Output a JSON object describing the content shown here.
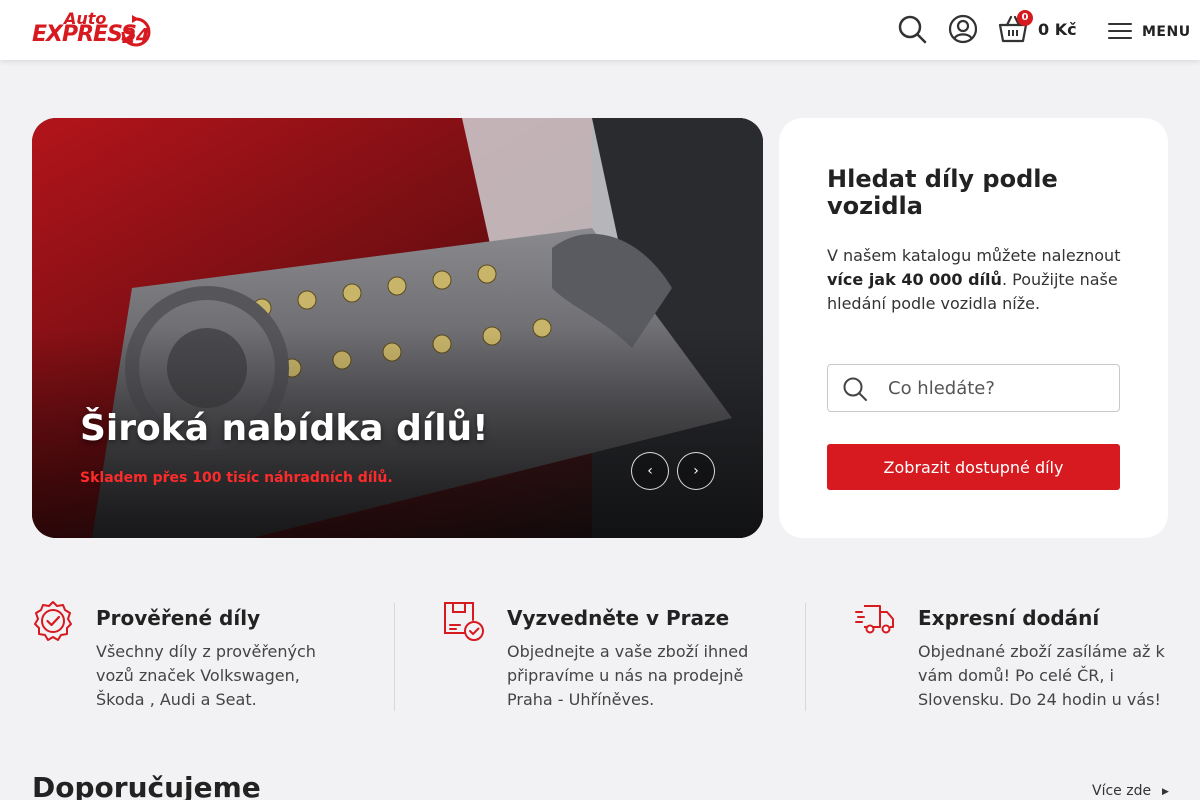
{
  "header": {
    "logo": {
      "line1": "Auto",
      "line2": "EXPRESS",
      "number": "24"
    },
    "cart_count": "0",
    "cart_total": "0 Kč",
    "menu_label": "MENU"
  },
  "hero": {
    "title": "Široká nabídka dílů!",
    "subtitle": "Skladem přes 100 tisíc náhradních dílů.",
    "prev_icon": "chevron-left-icon",
    "next_icon": "chevron-right-icon"
  },
  "search_card": {
    "title": "Hledat díly podle vozidla",
    "text_before": "V našem katalogu můžete naleznout ",
    "text_bold": "více jak 40 000 dílů",
    "text_after": ". Použijte naše hledání podle vozidla níže.",
    "input_placeholder": "Co hledáte?",
    "button_label": "Zobrazit dostupné díly"
  },
  "features": [
    {
      "icon": "verified-badge-icon",
      "title": "Prověřené díly",
      "text": "Všechny díly z prověřených vozů značek Volkswagen, Škoda , Audi a Seat."
    },
    {
      "icon": "store-pickup-icon",
      "title": "Vyzvedněte v Praze",
      "text": "Objednejte a vaše zboží ihned připravíme u nás na prodejně Praha - Uhříněves."
    },
    {
      "icon": "delivery-truck-icon",
      "title": "Expresní dodání",
      "text": "Objednané zboží zasíláme až k vám domů! Po celé ČR, i Slovensku. Do 24 hodin u vás!"
    }
  ],
  "recommended": {
    "title": "Doporučujeme",
    "more_label": "Více zde"
  },
  "colors": {
    "brand_red": "#d71920",
    "background": "#f2f2f4"
  }
}
